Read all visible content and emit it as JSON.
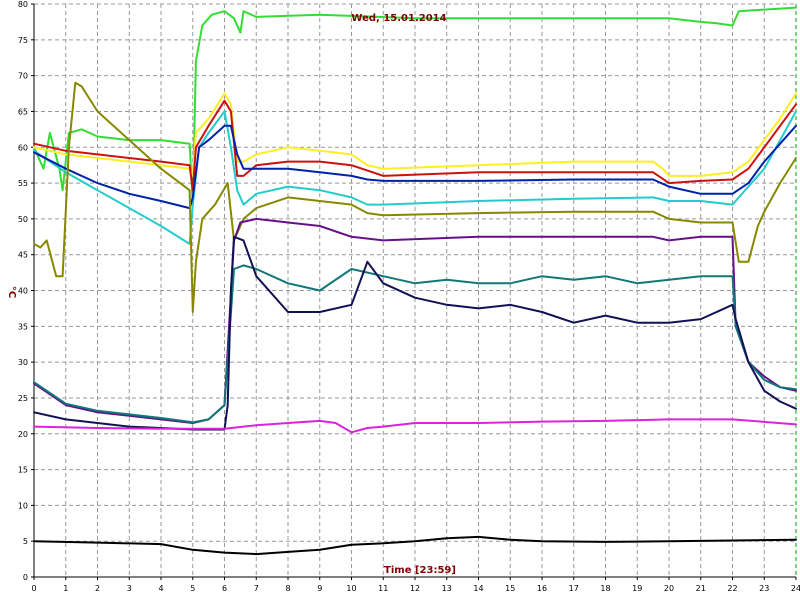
{
  "chart_data": {
    "type": "line",
    "title": "Wed, 15.01.2014",
    "xlabel": "Time [23:59]",
    "ylabel": "°C",
    "xlim": [
      0,
      24
    ],
    "ylim": [
      0,
      80
    ],
    "x_ticks": [
      0,
      1,
      2,
      3,
      4,
      5,
      6,
      7,
      8,
      9,
      10,
      11,
      12,
      13,
      14,
      15,
      16,
      17,
      18,
      19,
      20,
      21,
      22,
      23,
      24
    ],
    "y_ticks": [
      0,
      5,
      10,
      15,
      20,
      25,
      30,
      35,
      40,
      45,
      50,
      55,
      60,
      65,
      70,
      75,
      80
    ],
    "grid": true,
    "series": [
      {
        "color": "#33dd33",
        "points": [
          [
            0,
            60
          ],
          [
            0.3,
            57
          ],
          [
            0.5,
            62
          ],
          [
            0.8,
            57
          ],
          [
            0.9,
            54
          ],
          [
            1.1,
            62
          ],
          [
            1.5,
            62.5
          ],
          [
            2,
            61.5
          ],
          [
            3,
            61
          ],
          [
            4,
            61
          ],
          [
            4.9,
            60.5
          ],
          [
            5.0,
            52
          ],
          [
            5.1,
            72
          ],
          [
            5.3,
            77
          ],
          [
            5.6,
            78.5
          ],
          [
            6,
            79
          ],
          [
            6.3,
            78
          ],
          [
            6.5,
            76
          ],
          [
            6.6,
            79
          ],
          [
            7,
            78.2
          ],
          [
            9,
            78.5
          ],
          [
            12,
            78
          ],
          [
            15,
            78
          ],
          [
            18,
            78
          ],
          [
            20,
            78
          ],
          [
            21,
            77.5
          ],
          [
            21.5,
            77.3
          ],
          [
            22,
            77
          ],
          [
            22.2,
            79
          ],
          [
            24,
            79.5
          ]
        ]
      },
      {
        "color": "#ffee22",
        "points": [
          [
            0,
            60
          ],
          [
            1,
            59
          ],
          [
            2,
            58.5
          ],
          [
            3,
            58
          ],
          [
            4,
            57.5
          ],
          [
            4.9,
            57
          ],
          [
            5.0,
            56
          ],
          [
            5.1,
            62
          ],
          [
            5.5,
            64
          ],
          [
            6,
            67.5
          ],
          [
            6.2,
            66
          ],
          [
            6.4,
            58
          ],
          [
            6.6,
            58
          ],
          [
            7,
            59
          ],
          [
            8,
            60
          ],
          [
            9,
            59.5
          ],
          [
            10,
            59
          ],
          [
            10.5,
            57.5
          ],
          [
            11,
            57
          ],
          [
            14,
            57.5
          ],
          [
            17,
            58
          ],
          [
            19.5,
            58
          ],
          [
            19.8,
            57
          ],
          [
            20,
            56
          ],
          [
            21,
            56
          ],
          [
            22,
            56.5
          ],
          [
            22.5,
            58
          ],
          [
            23,
            61
          ],
          [
            23.5,
            64
          ],
          [
            24,
            67.5
          ]
        ]
      },
      {
        "color": "#cc1111",
        "points": [
          [
            0,
            60.5
          ],
          [
            1,
            59.5
          ],
          [
            2,
            59
          ],
          [
            3,
            58.5
          ],
          [
            4,
            58
          ],
          [
            4.9,
            57.5
          ],
          [
            5.0,
            54
          ],
          [
            5.1,
            60
          ],
          [
            5.5,
            63
          ],
          [
            6,
            66.5
          ],
          [
            6.2,
            65
          ],
          [
            6.4,
            56
          ],
          [
            6.6,
            56
          ],
          [
            7,
            57.5
          ],
          [
            8,
            58
          ],
          [
            9,
            58
          ],
          [
            10,
            57.5
          ],
          [
            11,
            56
          ],
          [
            14,
            56.5
          ],
          [
            17,
            56.5
          ],
          [
            19.5,
            56.5
          ],
          [
            20,
            55
          ],
          [
            21,
            55.3
          ],
          [
            22,
            55.5
          ],
          [
            22.5,
            57
          ],
          [
            23,
            60
          ],
          [
            23.5,
            63
          ],
          [
            24,
            66
          ]
        ]
      },
      {
        "color": "#22cccc",
        "points": [
          [
            0,
            59.5
          ],
          [
            1,
            56.5
          ],
          [
            2,
            54
          ],
          [
            3,
            51.5
          ],
          [
            4,
            49
          ],
          [
            4.9,
            46.5
          ],
          [
            5.0,
            52
          ],
          [
            5.2,
            60
          ],
          [
            5.5,
            62
          ],
          [
            6,
            65
          ],
          [
            6.2,
            60
          ],
          [
            6.4,
            54
          ],
          [
            6.6,
            52
          ],
          [
            7,
            53.5
          ],
          [
            8,
            54.5
          ],
          [
            9,
            54
          ],
          [
            10,
            53
          ],
          [
            10.5,
            52
          ],
          [
            11,
            52
          ],
          [
            14,
            52.5
          ],
          [
            17,
            52.8
          ],
          [
            19.5,
            53
          ],
          [
            20,
            52.5
          ],
          [
            21,
            52.5
          ],
          [
            22,
            52
          ],
          [
            22.2,
            53
          ],
          [
            23,
            57
          ],
          [
            23.5,
            61
          ],
          [
            24,
            65
          ]
        ]
      },
      {
        "color": "#0022aa",
        "points": [
          [
            0,
            59.3
          ],
          [
            1,
            57
          ],
          [
            2,
            55
          ],
          [
            3,
            53.5
          ],
          [
            4,
            52.5
          ],
          [
            4.9,
            51.5
          ],
          [
            5.0,
            53
          ],
          [
            5.2,
            60
          ],
          [
            5.5,
            61
          ],
          [
            6,
            63
          ],
          [
            6.2,
            63
          ],
          [
            6.4,
            59
          ],
          [
            6.6,
            57
          ],
          [
            7,
            57
          ],
          [
            8,
            57
          ],
          [
            9,
            56.5
          ],
          [
            10,
            56
          ],
          [
            10.5,
            55.5
          ],
          [
            11,
            55.3
          ],
          [
            14,
            55.3
          ],
          [
            17,
            55.5
          ],
          [
            19.5,
            55.5
          ],
          [
            20,
            54.5
          ],
          [
            21,
            53.5
          ],
          [
            22,
            53.5
          ],
          [
            22.5,
            55
          ],
          [
            23,
            58
          ],
          [
            23.5,
            60.5
          ],
          [
            24,
            63
          ]
        ]
      },
      {
        "color": "#888800",
        "points": [
          [
            0,
            46.5
          ],
          [
            0.2,
            46
          ],
          [
            0.4,
            47
          ],
          [
            0.7,
            42
          ],
          [
            0.9,
            42
          ],
          [
            1.1,
            60
          ],
          [
            1.3,
            69
          ],
          [
            1.5,
            68.5
          ],
          [
            2,
            65
          ],
          [
            3,
            61
          ],
          [
            4,
            57
          ],
          [
            4.9,
            54
          ],
          [
            5.0,
            37
          ],
          [
            5.1,
            44
          ],
          [
            5.3,
            50
          ],
          [
            5.7,
            52
          ],
          [
            6.1,
            55
          ],
          [
            6.3,
            47
          ],
          [
            6.6,
            50
          ],
          [
            7,
            51.5
          ],
          [
            8,
            53
          ],
          [
            9,
            52.5
          ],
          [
            10,
            52
          ],
          [
            10.5,
            50.8
          ],
          [
            11,
            50.5
          ],
          [
            14,
            50.8
          ],
          [
            17,
            51
          ],
          [
            19.5,
            51
          ],
          [
            20,
            50
          ],
          [
            21,
            49.5
          ],
          [
            22,
            49.5
          ],
          [
            22.2,
            44
          ],
          [
            22.5,
            44
          ],
          [
            22.8,
            49
          ],
          [
            23,
            51
          ],
          [
            23.5,
            55
          ],
          [
            24,
            58.5
          ]
        ]
      },
      {
        "color": "#661188",
        "points": [
          [
            0,
            27
          ],
          [
            1,
            24
          ],
          [
            2,
            23
          ],
          [
            3,
            22.5
          ],
          [
            4,
            22
          ],
          [
            5,
            21.5
          ],
          [
            5.5,
            22
          ],
          [
            6,
            24
          ],
          [
            6.3,
            47
          ],
          [
            6.5,
            49.5
          ],
          [
            7,
            50
          ],
          [
            8,
            49.5
          ],
          [
            9,
            49
          ],
          [
            10,
            47.5
          ],
          [
            11,
            47
          ],
          [
            14,
            47.5
          ],
          [
            17,
            47.5
          ],
          [
            19.5,
            47.5
          ],
          [
            20,
            47
          ],
          [
            21,
            47.5
          ],
          [
            22,
            47.5
          ],
          [
            22.1,
            35
          ],
          [
            22.5,
            30
          ],
          [
            23,
            28
          ],
          [
            23.5,
            26.5
          ],
          [
            24,
            26
          ]
        ]
      },
      {
        "color": "#117777",
        "points": [
          [
            0,
            27.2
          ],
          [
            1,
            24.2
          ],
          [
            2,
            23.2
          ],
          [
            3,
            22.7
          ],
          [
            4,
            22.2
          ],
          [
            5,
            21.6
          ],
          [
            5.5,
            22
          ],
          [
            6,
            24
          ],
          [
            6.3,
            43
          ],
          [
            6.6,
            43.5
          ],
          [
            7,
            43
          ],
          [
            8,
            41
          ],
          [
            8.5,
            40.5
          ],
          [
            9,
            40
          ],
          [
            10,
            43
          ],
          [
            11,
            42
          ],
          [
            12,
            41
          ],
          [
            13,
            41.5
          ],
          [
            14,
            41
          ],
          [
            15,
            41
          ],
          [
            16,
            42
          ],
          [
            17,
            41.5
          ],
          [
            18,
            42
          ],
          [
            19,
            41
          ],
          [
            20,
            41.5
          ],
          [
            21,
            42
          ],
          [
            22,
            42
          ],
          [
            22.1,
            35
          ],
          [
            22.5,
            30
          ],
          [
            23,
            27.5
          ],
          [
            23.5,
            26.5
          ],
          [
            24,
            26.2
          ]
        ]
      },
      {
        "color": "#111155",
        "points": [
          [
            0,
            23
          ],
          [
            1,
            22
          ],
          [
            2,
            21.5
          ],
          [
            3,
            21
          ],
          [
            4,
            20.8
          ],
          [
            5,
            20.6
          ],
          [
            6,
            20.6
          ],
          [
            6.1,
            24
          ],
          [
            6.2,
            40
          ],
          [
            6.3,
            47.5
          ],
          [
            6.6,
            47
          ],
          [
            7,
            42
          ],
          [
            8,
            37
          ],
          [
            9,
            37
          ],
          [
            10,
            38
          ],
          [
            10.5,
            44
          ],
          [
            11,
            41
          ],
          [
            12,
            39
          ],
          [
            13,
            38
          ],
          [
            14,
            37.5
          ],
          [
            15,
            38
          ],
          [
            16,
            37
          ],
          [
            17,
            35.5
          ],
          [
            18,
            36.5
          ],
          [
            19,
            35.5
          ],
          [
            20,
            35.5
          ],
          [
            21,
            36
          ],
          [
            22,
            38
          ],
          [
            22.1,
            36
          ],
          [
            22.5,
            30
          ],
          [
            23,
            26
          ],
          [
            23.5,
            24.5
          ],
          [
            24,
            23.5
          ]
        ]
      },
      {
        "color": "#dd22dd",
        "points": [
          [
            0,
            21
          ],
          [
            2,
            20.8
          ],
          [
            4,
            20.7
          ],
          [
            6,
            20.7
          ],
          [
            7,
            21.2
          ],
          [
            8,
            21.5
          ],
          [
            9,
            21.8
          ],
          [
            9.5,
            21.5
          ],
          [
            10,
            20.2
          ],
          [
            10.5,
            20.8
          ],
          [
            11,
            21
          ],
          [
            12,
            21.5
          ],
          [
            14,
            21.5
          ],
          [
            16,
            21.7
          ],
          [
            18,
            21.8
          ],
          [
            20,
            22
          ],
          [
            22,
            22
          ],
          [
            24,
            21.3
          ]
        ]
      },
      {
        "color": "#000000",
        "points": [
          [
            0,
            5
          ],
          [
            2,
            4.8
          ],
          [
            4,
            4.6
          ],
          [
            5,
            3.8
          ],
          [
            6,
            3.4
          ],
          [
            7,
            3.2
          ],
          [
            8,
            3.5
          ],
          [
            9,
            3.8
          ],
          [
            10,
            4.5
          ],
          [
            11,
            4.7
          ],
          [
            12,
            5
          ],
          [
            13,
            5.4
          ],
          [
            14,
            5.6
          ],
          [
            15,
            5.2
          ],
          [
            16,
            5
          ],
          [
            18,
            4.9
          ],
          [
            20,
            5
          ],
          [
            22,
            5.1
          ],
          [
            24,
            5.2
          ]
        ]
      }
    ]
  }
}
